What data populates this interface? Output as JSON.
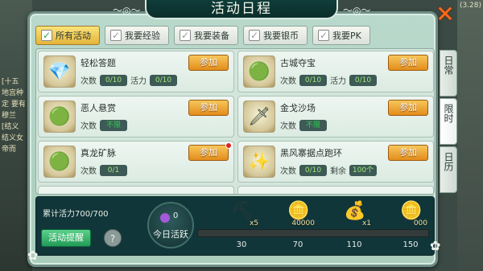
{
  "window": {
    "title": "活动日程",
    "close_icon": "orange-x-close-icon",
    "corner_score": "(3.28)"
  },
  "background": {
    "chat_lines": [
      "[十五",
      "地宫种",
      "定 要有",
      "穆兰",
      "[结义",
      "结义女",
      "帝而"
    ]
  },
  "tabs": [
    {
      "label": "所有活动",
      "active": true
    },
    {
      "label": "我要经验",
      "active": false
    },
    {
      "label": "我要装备",
      "active": false
    },
    {
      "label": "我要银币",
      "active": false
    },
    {
      "label": "我要PK",
      "active": false
    }
  ],
  "activities": [
    {
      "name": "轻松答题",
      "icon": "gem-scroll-icon",
      "count_label": "次数",
      "count": "0/10",
      "vigor_label": "活力",
      "vigor": "0/10",
      "button": "参加",
      "badge": false
    },
    {
      "name": "古城夺宝",
      "icon": "green-gem-icon",
      "count_label": "次数",
      "count": "0/10",
      "vigor_label": "活力",
      "vigor": "0/10",
      "button": "参加",
      "badge": false
    },
    {
      "name": "恶人悬赏",
      "icon": "green-gem-icon",
      "count_label": "次数",
      "count": "不限",
      "vigor_label": "",
      "vigor": "",
      "button": "参加",
      "badge": false
    },
    {
      "name": "金戈沙场",
      "icon": "spear-icon",
      "count_label": "次数",
      "count": "不限",
      "vigor_label": "",
      "vigor": "",
      "button": "参加",
      "badge": false
    },
    {
      "name": "真龙矿脉",
      "icon": "green-gem-icon",
      "count_label": "次数",
      "count": "0/1",
      "vigor_label": "",
      "vigor": "",
      "button": "参加",
      "badge": true
    },
    {
      "name": "黑风寨据点跑环",
      "icon": "golden-orb-icon",
      "count_label": "次数",
      "count": "0/10",
      "vigor_label": "剩余",
      "vigor": "100个",
      "button": "参加",
      "badge": false
    }
  ],
  "side_tabs": [
    {
      "label": "日常",
      "active": false
    },
    {
      "label": "限时",
      "active": true
    },
    {
      "label": "日历",
      "active": false
    }
  ],
  "bottom": {
    "cumulative": "累计活力700/700",
    "remind_button": "活动提醒",
    "help_icon": "question-mark-icon",
    "today_gem_count": "0",
    "today_label": "今日活跃",
    "progress_fraction": 0,
    "rewards": [
      {
        "icon": "pickaxe-icon",
        "qty": "x5",
        "threshold": "30"
      },
      {
        "icon": "silver-coins-icon",
        "qty": "40000",
        "threshold": "70"
      },
      {
        "icon": "money-bag-icon",
        "qty": "x1",
        "threshold": "110"
      },
      {
        "icon": "gold-coins-icon",
        "qty": "000",
        "threshold": "150"
      }
    ]
  },
  "colors": {
    "join_button": "#e8961f",
    "frame": "#b9d9cc",
    "title_bar": "#0f3d3a",
    "close": "#ff6a1a"
  }
}
